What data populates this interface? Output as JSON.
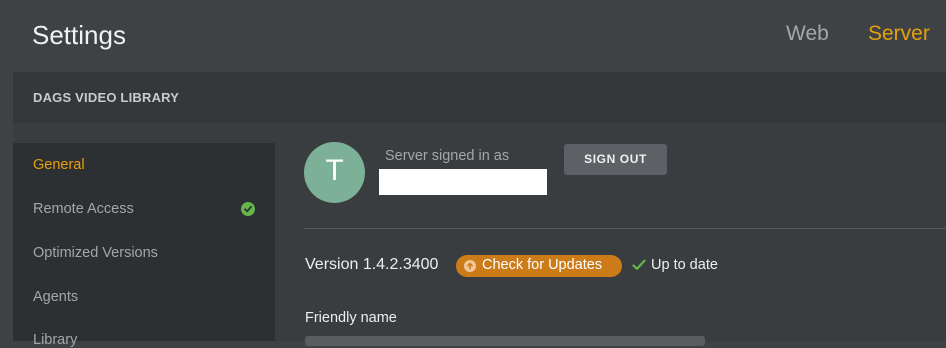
{
  "header": {
    "title": "Settings",
    "tabs": [
      {
        "label": "Web",
        "active": false
      },
      {
        "label": "Server",
        "active": true
      }
    ]
  },
  "library": {
    "name": "DAGS VIDEO LIBRARY"
  },
  "sidebar": {
    "items": [
      {
        "label": "General",
        "active": true
      },
      {
        "label": "Remote Access",
        "status_icon": "check-circle-icon"
      },
      {
        "label": "Optimized Versions"
      },
      {
        "label": "Agents"
      },
      {
        "label": "Library"
      }
    ]
  },
  "account": {
    "avatar_letter": "T",
    "signed_in_label": "Server signed in as",
    "sign_out_label": "SIGN OUT"
  },
  "version": {
    "text": "Version 1.4.2.3400",
    "check_updates_label": "Check for Updates",
    "status_text": "Up to date"
  },
  "friendly_name": {
    "label": "Friendly name"
  },
  "colors": {
    "accent": "#e5a00d",
    "update_button": "#cc7b19",
    "success": "#64b649",
    "avatar": "#7db197"
  }
}
